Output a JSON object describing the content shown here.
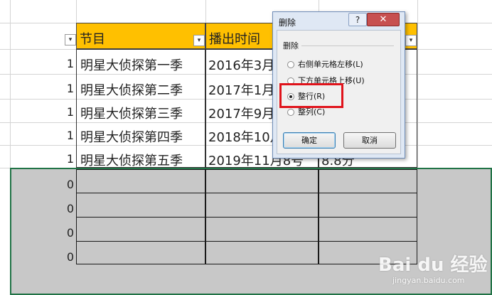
{
  "columns": {
    "b_header": "节目",
    "c_header": "播出时间"
  },
  "rows": [
    {
      "num": "1",
      "name": "明星大侦探第一季",
      "date": "2016年3月",
      "extra": ""
    },
    {
      "num": "1",
      "name": "明星大侦探第二季",
      "date": "2017年1月",
      "extra": ""
    },
    {
      "num": "1",
      "name": "明星大侦探第三季",
      "date": "2017年9月",
      "extra": ""
    },
    {
      "num": "1",
      "name": "明星大侦探第四季",
      "date": "2018年10月",
      "extra": ""
    },
    {
      "num": "1",
      "name": "明星大侦探第五季",
      "date": "2019年11月8号",
      "extra": "8.8分"
    }
  ],
  "empty_rows": [
    {
      "num": "0"
    },
    {
      "num": "0"
    },
    {
      "num": "0"
    },
    {
      "num": "0"
    }
  ],
  "dialog": {
    "title": "删除",
    "help": "?",
    "close": "✕",
    "group_label": "删除",
    "options": [
      {
        "label": "右侧单元格左移(L)",
        "checked": false
      },
      {
        "label": "下方单元格上移(U)",
        "checked": false
      },
      {
        "label": "整行(R)",
        "checked": true
      },
      {
        "label": "整列(C)",
        "checked": false
      }
    ],
    "ok": "确定",
    "cancel": "取消"
  },
  "watermark": {
    "brand": "Bai du 经验",
    "url": "jingyan.baidu.com"
  },
  "colors": {
    "header_fill": "#ffc000",
    "selection_fill": "#c8c8c8",
    "selection_border": "#217346",
    "highlight_box": "#e0131b",
    "close_button": "#c75050"
  }
}
